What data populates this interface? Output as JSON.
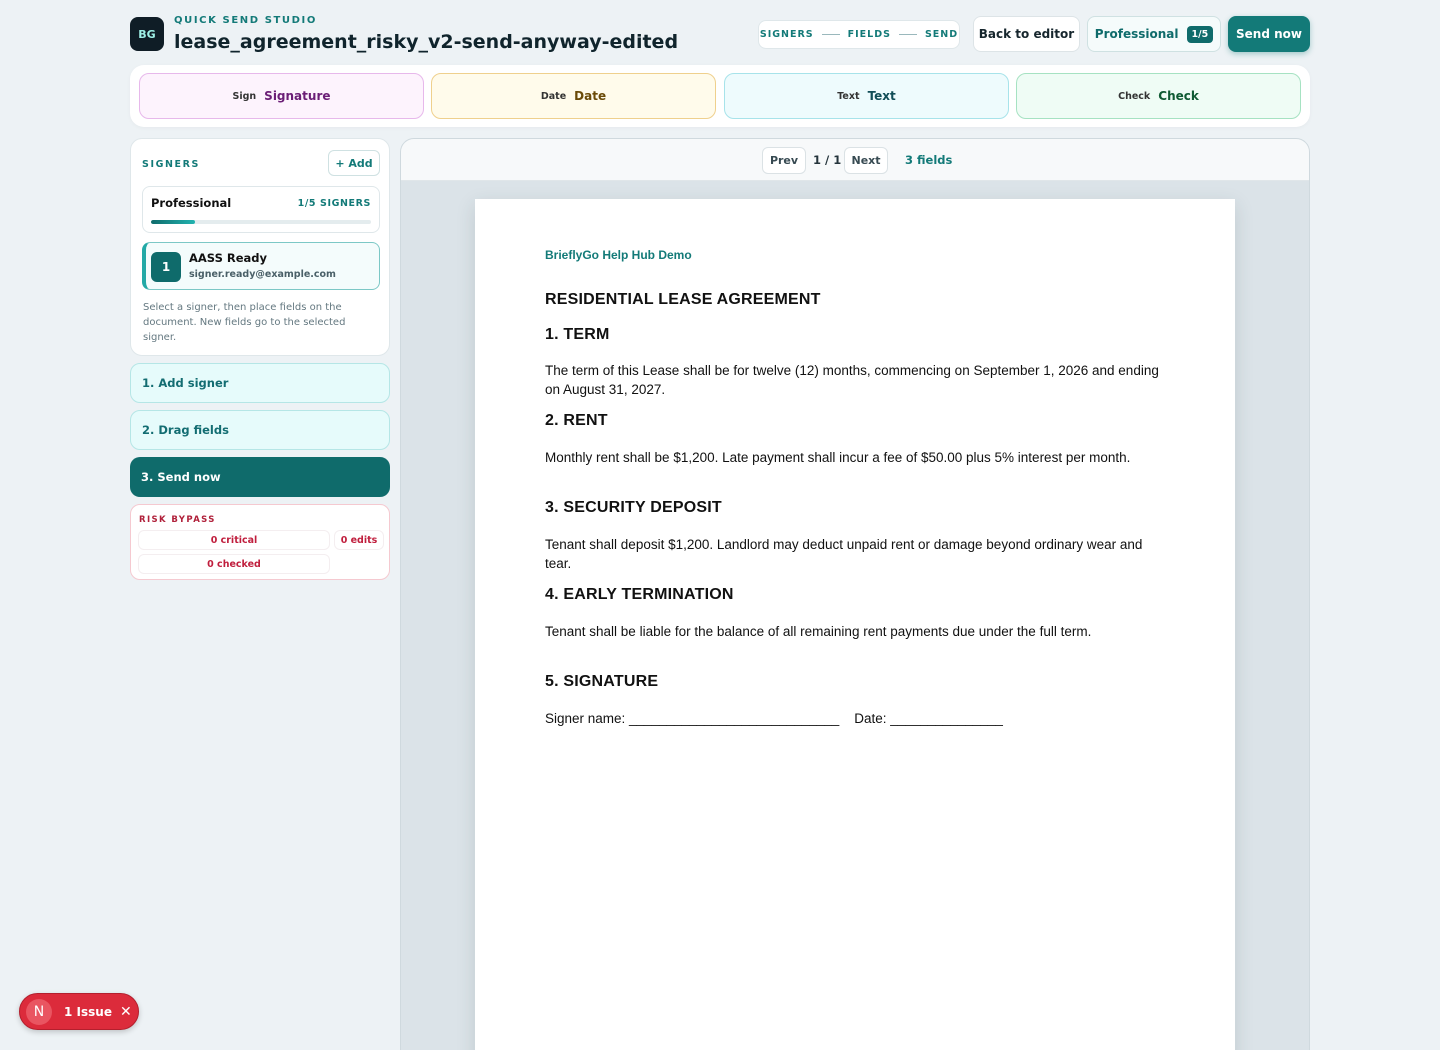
{
  "header": {
    "logo_text": "BG",
    "eyebrow": "QUICK SEND STUDIO",
    "document_title": "lease_agreement_risky_v2-send-anyway-edited",
    "steps": [
      "SIGNERS",
      "FIELDS",
      "SEND"
    ],
    "back_label": "Back to editor",
    "plan_label": "Professional",
    "plan_badge": "1/5",
    "send_label": "Send now"
  },
  "palette": {
    "sign": {
      "tag": "Sign",
      "label": "Signature"
    },
    "date": {
      "tag": "Date",
      "label": "Date"
    },
    "text": {
      "tag": "Text",
      "label": "Text"
    },
    "check": {
      "tag": "Check",
      "label": "Check"
    }
  },
  "signers": {
    "heading": "SIGNERS",
    "add_label": "+ Add",
    "plan_name": "Professional",
    "plan_count": "1/5 SIGNERS",
    "plan_usage_fraction": 0.2,
    "items": [
      {
        "number": "1",
        "name": "AASS Ready",
        "email": "signer.ready@example.com"
      }
    ],
    "help": "Select a signer, then place fields on the document. New fields go to the selected signer."
  },
  "workflow": {
    "add_signer": "1. Add signer",
    "drag_fields": "2. Drag fields",
    "send_now": "3. Send now"
  },
  "risk": {
    "heading": "RISK BYPASS",
    "critical": "0 critical",
    "edits": "0 edits",
    "checked": "0 checked"
  },
  "viewer": {
    "prev_label": "Prev",
    "page_indicator": "1 / 1",
    "next_label": "Next",
    "field_count": "3 fields"
  },
  "document": {
    "org": "BrieflyGo Help Hub Demo",
    "title": "RESIDENTIAL LEASE AGREEMENT",
    "s1_heading": "1. TERM",
    "s1_body": "The term of this Lease shall be for twelve (12) months, commencing on September 1, 2026 and ending on August 31, 2027.",
    "s2_heading": "2. RENT",
    "s2_body": "Monthly rent shall be $1,200. Late payment shall incur a fee of $50.00 plus 5% interest per month.",
    "s3_heading": "3. SECURITY DEPOSIT",
    "s3_body": "Tenant shall deposit $1,200. Landlord may deduct unpaid rent or damage beyond ordinary wear and tear.",
    "s4_heading": "4. EARLY TERMINATION",
    "s4_body": "Tenant shall be liable for the balance of all remaining rent payments due under the full term.",
    "s5_heading": "5. SIGNATURE",
    "signature_line": "Signer name: ____________________________    Date: _______________"
  },
  "issue_badge": {
    "icon_letter": "N",
    "label": "1 Issue",
    "close": "✕"
  },
  "colors": {
    "accent": "#137a78",
    "accent_dark": "#0f6b6b",
    "danger": "#dc2b3b",
    "background": "#edf2f5"
  }
}
